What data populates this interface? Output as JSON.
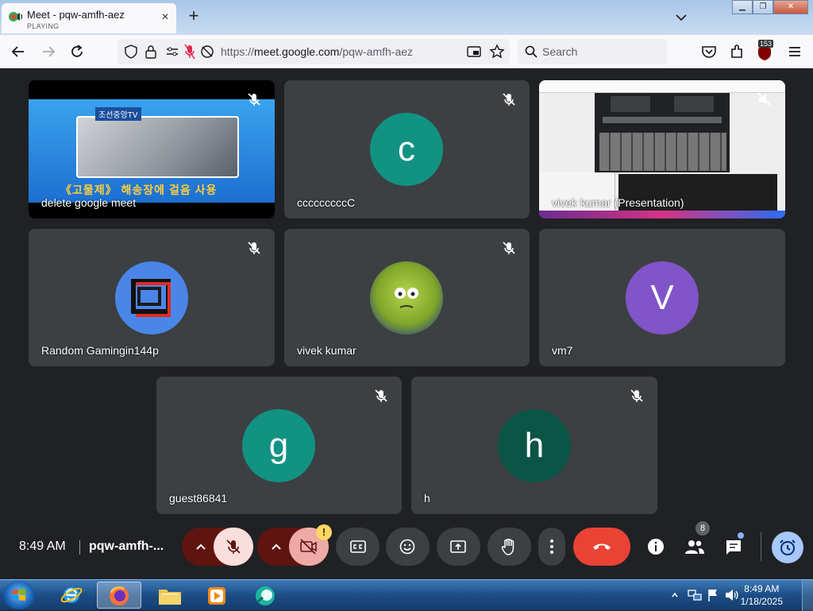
{
  "browser": {
    "tab": {
      "title": "Meet - pqw-amfh-aez",
      "status": "PLAYING"
    },
    "url": {
      "prefix": "https://",
      "host": "meet.google.com",
      "path": "/pqw-amfh-aez"
    },
    "search_placeholder": "Search",
    "extension_badge": "153"
  },
  "tiles": [
    {
      "name": "delete google meet",
      "kind": "video",
      "caption": "《고물제》 해송장에 걸음 사용",
      "channel": "조선중앙TV"
    },
    {
      "name": "cccccccccC",
      "kind": "avatar",
      "letter": "c",
      "color": "#129283"
    },
    {
      "name": "vivek kumar (Presentation)",
      "kind": "presentation"
    },
    {
      "name": "Random Gamingin144p",
      "kind": "avatar-logo",
      "color": "#4a86e8"
    },
    {
      "name": "vivek kumar",
      "kind": "avatar-photo"
    },
    {
      "name": "vm7",
      "kind": "avatar",
      "letter": "V",
      "color": "#8154c9"
    },
    {
      "name": "guest86841",
      "kind": "avatar",
      "letter": "g",
      "color": "#129283"
    },
    {
      "name": "h",
      "kind": "avatar",
      "letter": "h",
      "color": "#0b5546"
    }
  ],
  "controls": {
    "time": "8:49 AM",
    "meeting_code": "pqw-amfh-...",
    "people_count": "8",
    "camera_warning": "!"
  },
  "taskbar": {
    "time": "8:49 AM",
    "date": "1/18/2025"
  },
  "colors": {
    "meet_bg": "#202124",
    "tile_bg": "#3c4043",
    "end_call": "#ea4335",
    "mic_cam_off": "#f9dedc",
    "accent_blue": "#a8c7fa"
  }
}
